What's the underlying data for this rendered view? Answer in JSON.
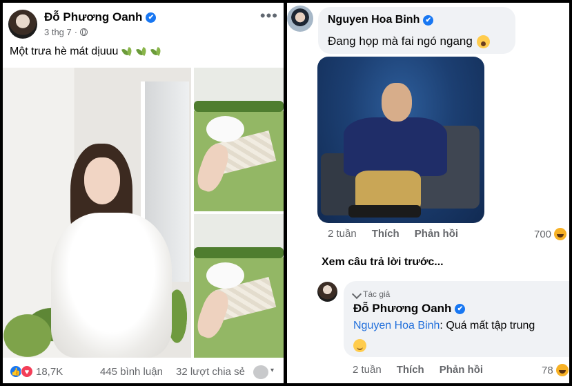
{
  "post": {
    "author": "Đỗ Phương Oanh",
    "verified_mark": "✔",
    "date": "3 thg 7",
    "privacy_separator": "·",
    "more_label": "•••",
    "text": "Một trưa hè mát dịuuu",
    "reactions_count": "18,7K",
    "comments_count": "445 bình luận",
    "shares_count": "32 lượt chia sẻ",
    "share_caret": "▾",
    "like_glyph": "👍",
    "love_glyph": "♥"
  },
  "comment": {
    "author": "Nguyen Hoa Binh",
    "verified_mark": "✔",
    "text": "Đang họp mà fai ngó ngang",
    "time": "2 tuần",
    "like_label": "Thích",
    "reply_label": "Phản hồi",
    "reaction_count": "700",
    "view_previous_replies": "Xem câu trả lời trước..."
  },
  "reply": {
    "author_badge": "Tác giả",
    "author": "Đỗ Phương Oanh",
    "verified_mark": "✔",
    "mention": "Nguyen Hoa Binh",
    "text": ": Quá mất tập trung",
    "time": "2 tuần",
    "like_label": "Thích",
    "reply_label": "Phản hồi",
    "reaction_count": "78"
  },
  "colors": {
    "facebook_blue": "#1877f2",
    "love_red": "#f33e58",
    "mention_blue": "#216fdb",
    "bubble_gray": "#f0f2f5",
    "meta_gray": "#65676b"
  },
  "icons": {
    "privacy": "globe-icon",
    "post_decoration": "leaf-icon",
    "comment_emoji": "screaming-face-emoji",
    "reply_emoji": "smiling-face-emoji",
    "comment_reaction": "haha-reaction-icon"
  }
}
